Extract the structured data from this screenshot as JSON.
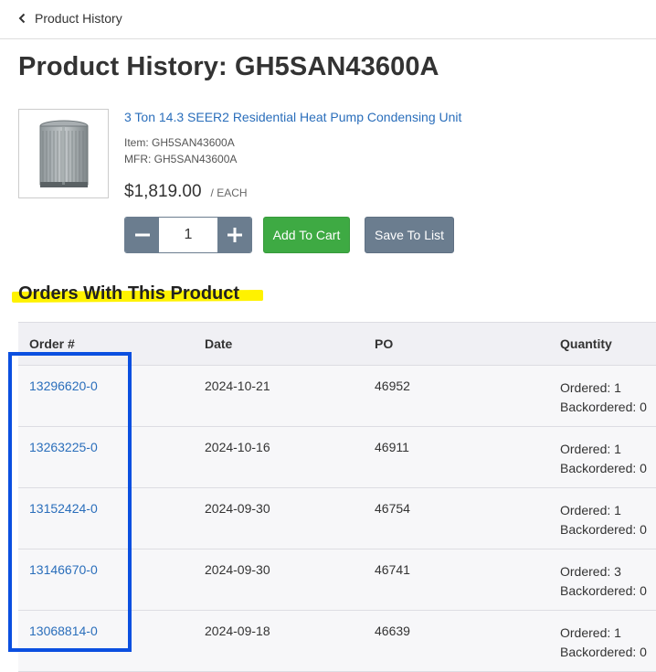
{
  "nav": {
    "back_label": "Product History"
  },
  "page": {
    "title": "Product History: GH5SAN43600A"
  },
  "product": {
    "name": "3 Ton 14.3 SEER2 Residential Heat Pump Condensing Unit",
    "item": "Item: GH5SAN43600A",
    "mfr": "MFR: GH5SAN43600A",
    "price": "$1,819.00",
    "unit": "/ EACH",
    "quantity": "1",
    "image_icon": "condenser-unit-image"
  },
  "actions": {
    "add_to_cart": "Add To Cart",
    "save_to_list": "Save To List"
  },
  "orders": {
    "title": "Orders With This Product",
    "headers": [
      "Order #",
      "Date",
      "PO",
      "Quantity"
    ],
    "rows": [
      {
        "order": "13296620-0",
        "date": "2024-10-21",
        "po": "46952",
        "ordered": "Ordered: 1",
        "backordered": "Backordered: 0"
      },
      {
        "order": "13263225-0",
        "date": "2024-10-16",
        "po": "46911",
        "ordered": "Ordered: 1",
        "backordered": "Backordered: 0"
      },
      {
        "order": "13152424-0",
        "date": "2024-09-30",
        "po": "46754",
        "ordered": "Ordered: 1",
        "backordered": "Backordered: 0"
      },
      {
        "order": "13146670-0",
        "date": "2024-09-30",
        "po": "46741",
        "ordered": "Ordered: 3",
        "backordered": "Backordered: 0"
      },
      {
        "order": "13068814-0",
        "date": "2024-09-18",
        "po": "46639",
        "ordered": "Ordered: 1",
        "backordered": "Backordered: 0"
      }
    ]
  },
  "colors": {
    "link": "#2a6ebb",
    "add_to_cart": "#3eaa43",
    "secondary": "#6b7d8f",
    "highlight": "#fff200",
    "annotation": "#0b4fe0"
  }
}
